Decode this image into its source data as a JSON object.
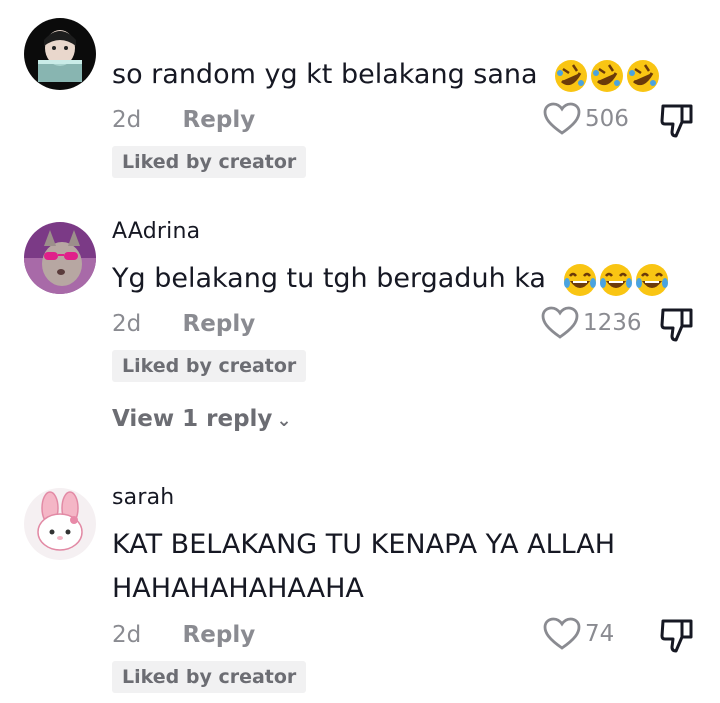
{
  "comments": [
    {
      "username": "",
      "text": "so random yg kt belakang sana",
      "emoji": [
        "rofl-emoji",
        "rofl-emoji",
        "rofl-emoji"
      ],
      "time": "2d",
      "reply": "Reply",
      "likes": "506",
      "badge": "Liked by creator"
    },
    {
      "username": "AAdrina",
      "text": "Yg belakang tu tgh bergaduh ka",
      "emoji": [
        "tears-of-joy-emoji",
        "tears-of-joy-emoji",
        "tears-of-joy-emoji"
      ],
      "time": "2d",
      "reply": "Reply",
      "likes": "1236",
      "badge": "Liked by creator",
      "view_replies": "View 1 reply"
    },
    {
      "username": "sarah",
      "text_lines": [
        "KAT BELAKANG TU KENAPA YA ALLAH",
        "HAHAHAHAHAAHA"
      ],
      "time": "2d",
      "reply": "Reply",
      "likes": "74",
      "badge": "Liked by creator"
    }
  ],
  "colors": {
    "text": "#161823",
    "meta": "#8a8b91",
    "badge_bg": "#f1f1f2"
  }
}
